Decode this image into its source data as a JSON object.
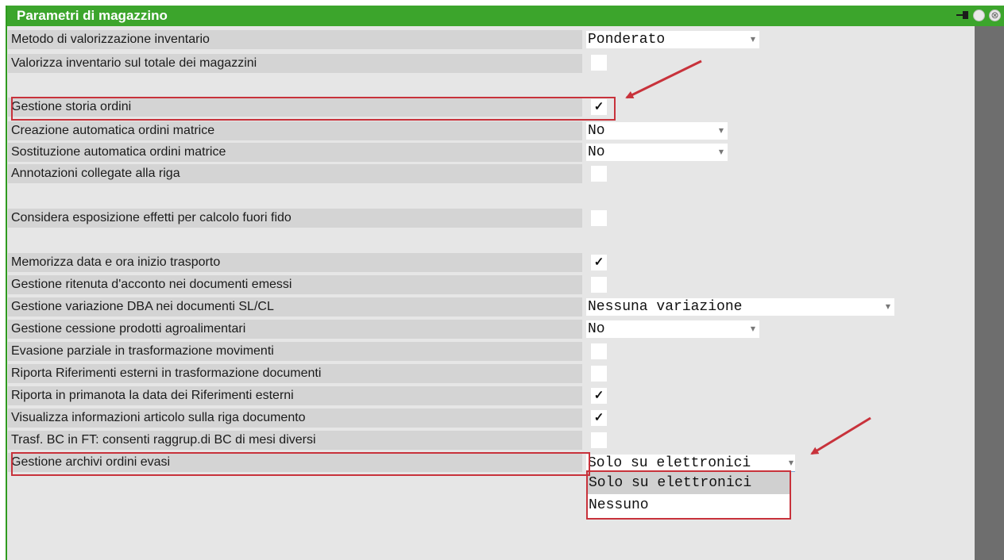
{
  "window": {
    "title": "Parametri di magazzino"
  },
  "rows": [
    {
      "label": "Metodo di valorizzazione inventario",
      "control": "select",
      "value": "Ponderato"
    },
    {
      "label": "Valorizza inventario sul totale dei magazzini",
      "control": "checkbox",
      "checked": false
    },
    {
      "label": "Gestione storia ordini",
      "control": "checkbox",
      "checked": true
    },
    {
      "label": "Creazione automatica ordini matrice",
      "control": "select",
      "value": "No"
    },
    {
      "label": "Sostituzione automatica ordini matrice",
      "control": "select",
      "value": "No"
    },
    {
      "label": "Annotazioni collegate alla riga",
      "control": "checkbox",
      "checked": false
    },
    {
      "label": "Considera esposizione effetti per calcolo fuori fido",
      "control": "checkbox",
      "checked": false
    },
    {
      "label": "Memorizza data e ora inizio trasporto",
      "control": "checkbox",
      "checked": true
    },
    {
      "label": "Gestione ritenuta d'acconto nei documenti emessi",
      "control": "checkbox",
      "checked": false
    },
    {
      "label": "Gestione variazione DBA nei documenti SL/CL",
      "control": "select",
      "value": "Nessuna variazione"
    },
    {
      "label": "Gestione cessione prodotti agroalimentari",
      "control": "select",
      "value": "No"
    },
    {
      "label": "Evasione parziale in trasformazione movimenti",
      "control": "checkbox",
      "checked": false
    },
    {
      "label": "Riporta Riferimenti esterni in trasformazione documenti",
      "control": "checkbox",
      "checked": false
    },
    {
      "label": "Riporta in primanota la data dei Riferimenti esterni",
      "control": "checkbox",
      "checked": true
    },
    {
      "label": "Visualizza informazioni articolo sulla riga documento",
      "control": "checkbox",
      "checked": true
    },
    {
      "label": "Trasf. BC in FT: consenti raggrup.di BC di mesi diversi",
      "control": "checkbox",
      "checked": false
    },
    {
      "label": "Gestione archivi ordini evasi",
      "control": "select",
      "value": "Solo su elettronici"
    }
  ],
  "dropdown": {
    "options": [
      "Solo su elettronici",
      "Nessuno"
    ],
    "highlighted": "Solo su elettronici"
  },
  "glyphs": {
    "check": "✓",
    "dropdown_arrow": "▼",
    "close": "⊗"
  },
  "colors": {
    "titlebar": "#3ca52c",
    "annotation": "#c8323b",
    "row": "#d4d4d4",
    "scrollbar": "#6e6e6e"
  }
}
